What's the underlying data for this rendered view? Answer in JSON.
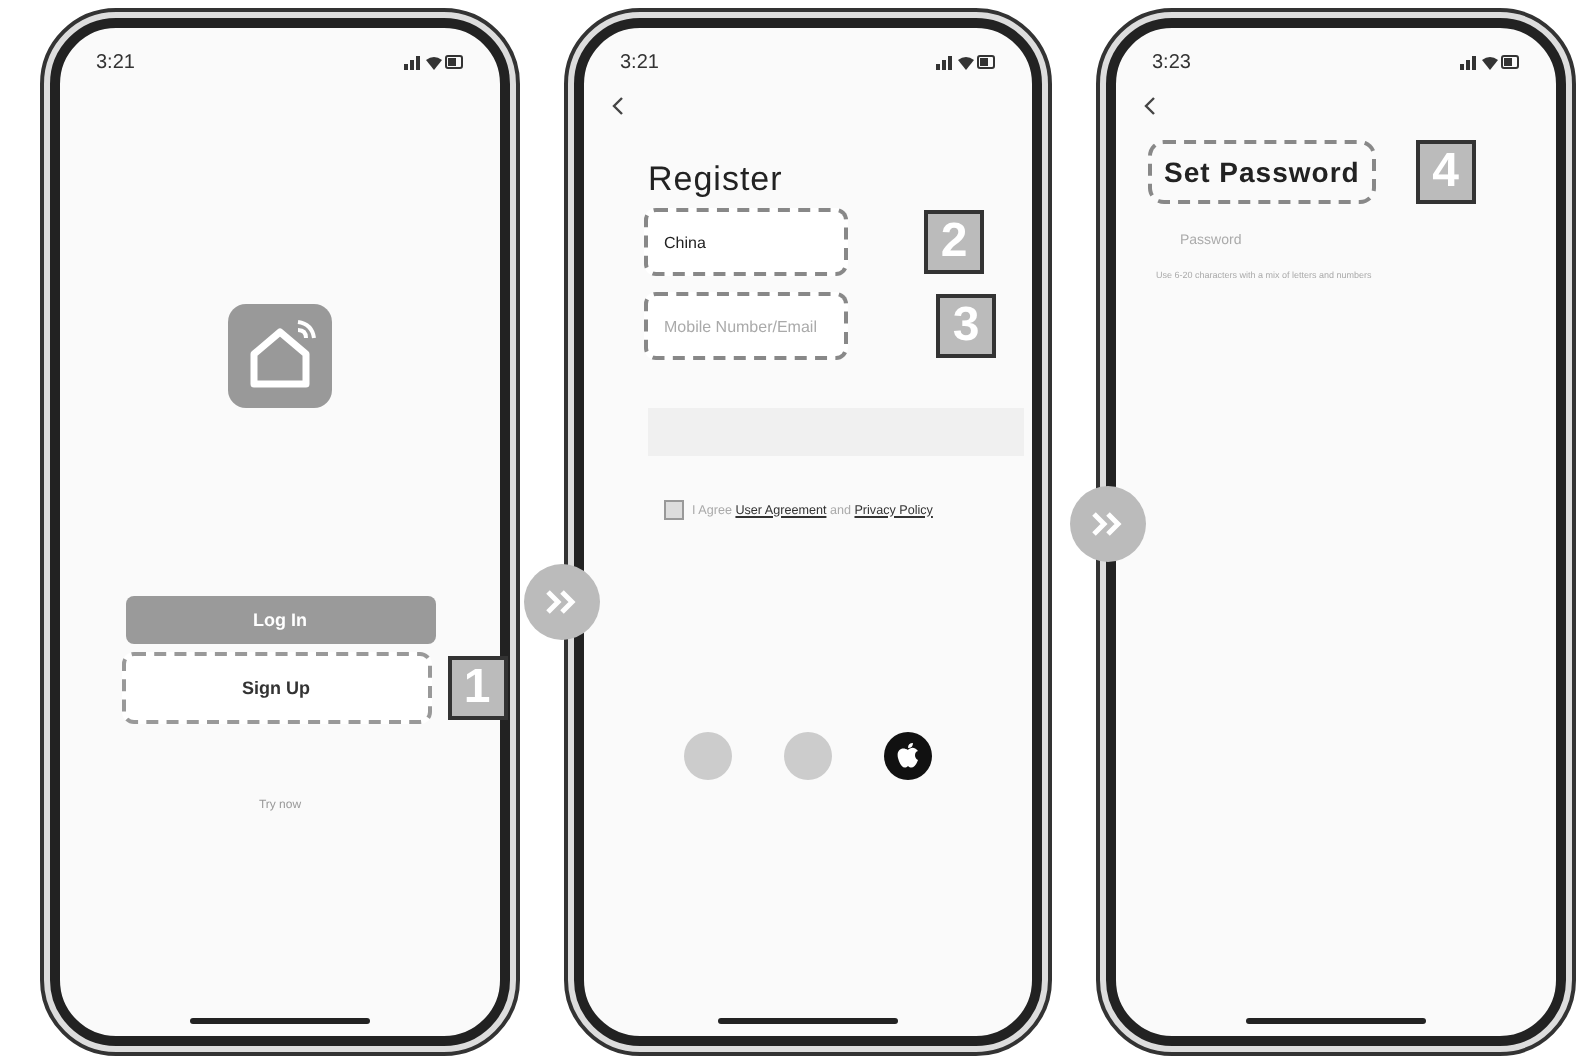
{
  "screens": [
    {
      "kind": "welcome",
      "time": "3:21",
      "buttons": [
        {
          "label": "Log In",
          "kind": "filled"
        },
        {
          "label": "Sign Up",
          "kind": "outlined",
          "step": "1"
        }
      ],
      "link": "Try now"
    },
    {
      "kind": "register",
      "time": "3:21",
      "title": "Register",
      "fields": [
        {
          "value": "China",
          "step": "2"
        },
        {
          "placeholder": "Mobile Number/Email",
          "step": "3"
        }
      ],
      "agreement": {
        "checked": false,
        "parts": [
          {
            "text": "I Agree",
            "kind": "plain"
          },
          {
            "text": "User Agreement",
            "kind": "link"
          },
          {
            "text": "and",
            "kind": "plain"
          },
          {
            "text": "Privacy Policy",
            "kind": "link"
          }
        ]
      },
      "social": [
        {
          "kind": "muted"
        },
        {
          "kind": "muted"
        },
        {
          "kind": "apple"
        }
      ]
    },
    {
      "kind": "password",
      "time": "3:23",
      "title": "Set Password",
      "step": "4",
      "field": {
        "placeholder": "Password"
      },
      "hint": "Use 6-20 characters with a mix of letters and numbers"
    }
  ]
}
